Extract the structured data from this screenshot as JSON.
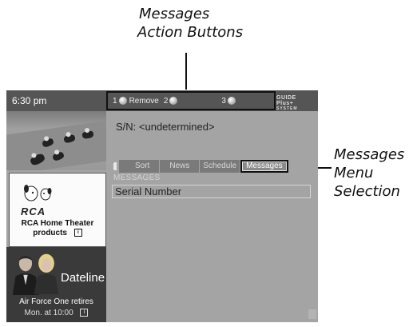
{
  "callouts": {
    "top_line1": "Messages",
    "top_line2": "Action Buttons",
    "right_line1": "Messages",
    "right_line2": "Menu",
    "right_line3": "Selection"
  },
  "topbar": {
    "time": "6:30 pm",
    "buttons": [
      {
        "number": "1",
        "label": "Remove"
      },
      {
        "number": "2",
        "label": ""
      },
      {
        "number": "3",
        "label": ""
      }
    ],
    "logo_text": "GUIDE Plus+",
    "logo_sub": "SYSTEM"
  },
  "serial": {
    "text": "S/N: <undetermined>"
  },
  "tabs": [
    {
      "label": "Sort"
    },
    {
      "label": "News"
    },
    {
      "label": "Schedule"
    },
    {
      "label": "Messages",
      "selected": true
    }
  ],
  "section": {
    "label": "MESSAGES",
    "items": [
      "Serial Number"
    ]
  },
  "ad": {
    "brand": "RCA",
    "line1": "RCA Home Theater",
    "line2": "products",
    "badge": "i"
  },
  "show": {
    "title": "Dateline",
    "description": "Air Force One retires",
    "time": "Mon. at 10:00",
    "badge": "i"
  }
}
